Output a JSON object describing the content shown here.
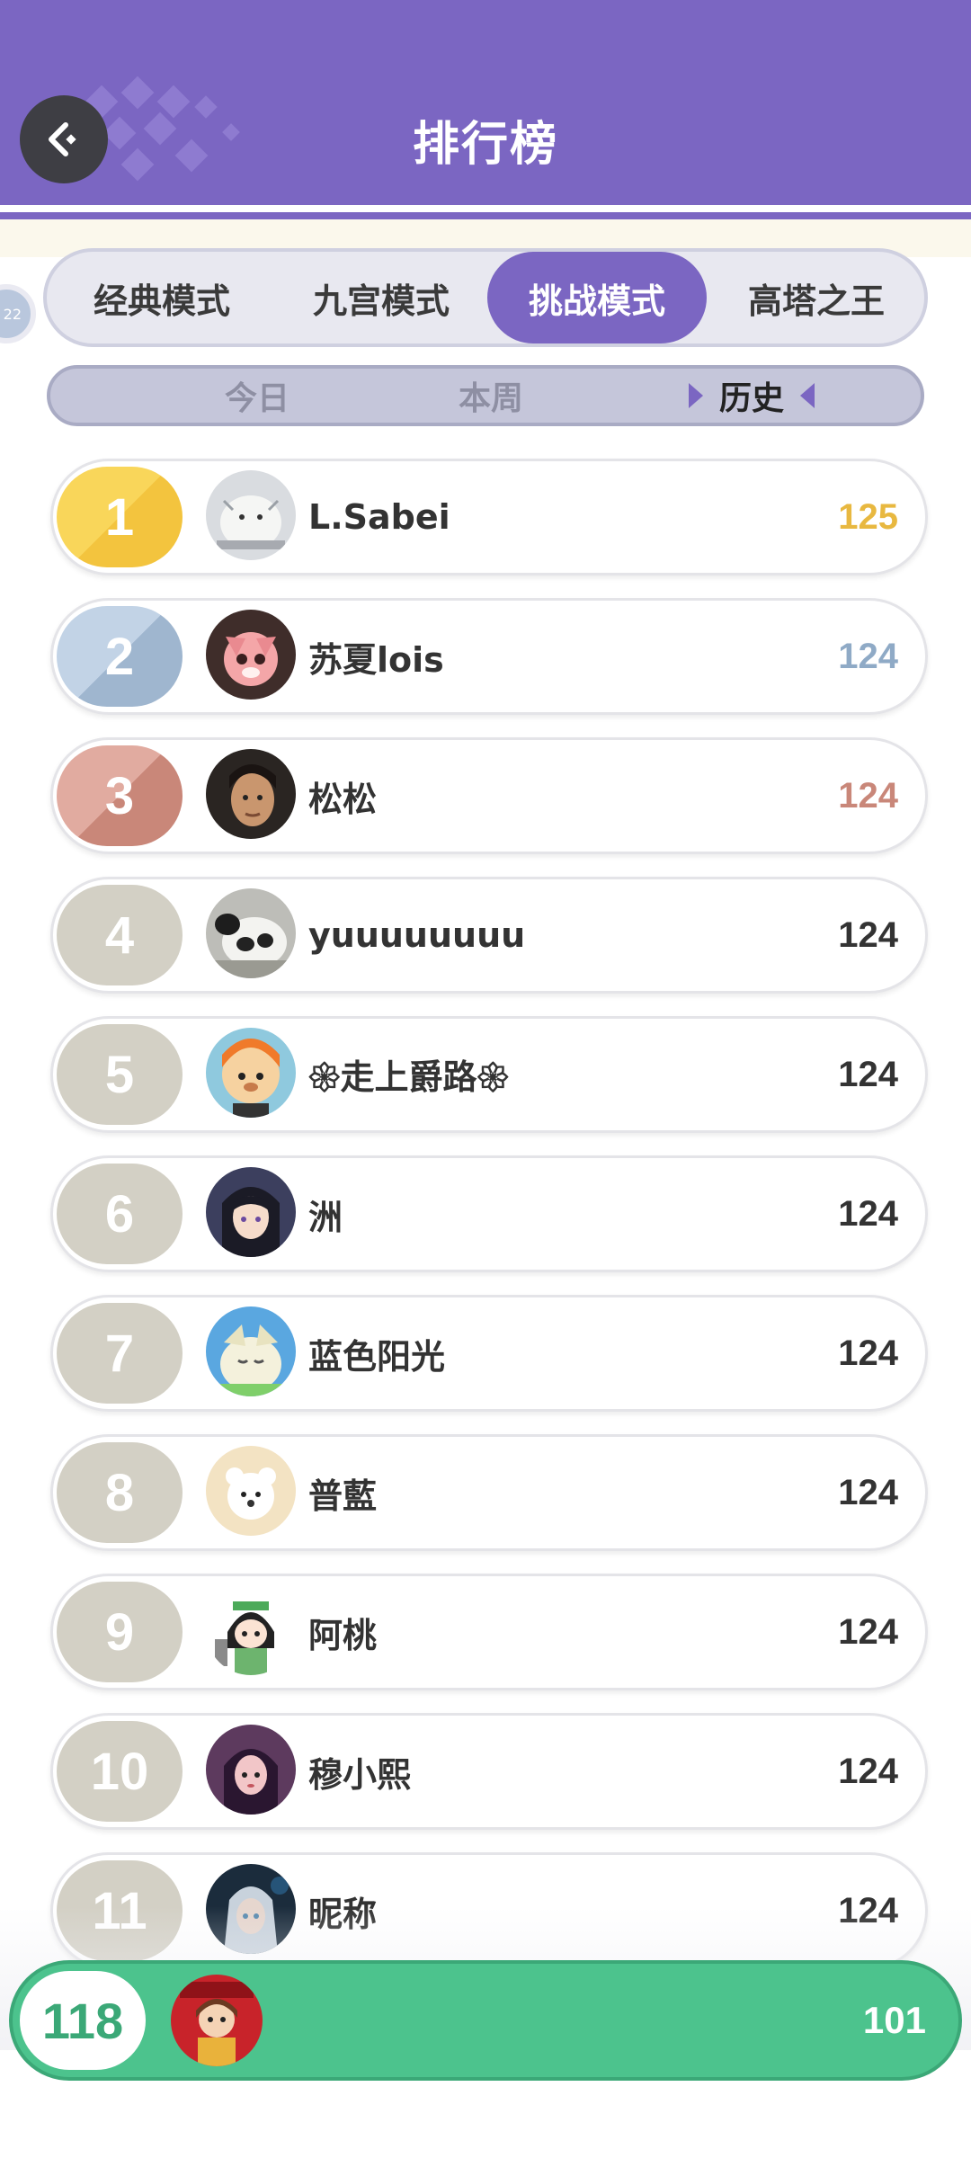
{
  "header": {
    "title": "排行榜"
  },
  "side_badge": {
    "text": "22"
  },
  "mode_tabs": [
    {
      "label": "经典模式",
      "active": false
    },
    {
      "label": "九宫模式",
      "active": false
    },
    {
      "label": "挑战模式",
      "active": true
    },
    {
      "label": "高塔之王",
      "active": false
    }
  ],
  "period_tabs": [
    {
      "label": "今日",
      "active": false
    },
    {
      "label": "本周",
      "active": false
    },
    {
      "label": "历史",
      "active": true
    }
  ],
  "rankings": [
    {
      "rank": "1",
      "name": "L.Sabei",
      "score": "125",
      "medal": "gold",
      "avatar_icon": "white-creature-avatar-icon"
    },
    {
      "rank": "2",
      "name": "苏夏lois",
      "score": "124",
      "medal": "silver",
      "avatar_icon": "pink-fox-avatar-icon"
    },
    {
      "rank": "3",
      "name": "松松",
      "score": "124",
      "medal": "bronze",
      "avatar_icon": "man-portrait-avatar-icon"
    },
    {
      "rank": "4",
      "name": "yuuuuuuuu",
      "score": "124",
      "medal": "",
      "avatar_icon": "panda-avatar-icon"
    },
    {
      "rank": "5",
      "name": "𑁍走上爵路𑁍",
      "score": "124",
      "medal": "",
      "avatar_icon": "cartoon-boy-avatar-icon"
    },
    {
      "rank": "6",
      "name": "洲",
      "score": "124",
      "medal": "",
      "avatar_icon": "anime-girl-avatar-icon"
    },
    {
      "rank": "7",
      "name": "蓝色阳光",
      "score": "124",
      "medal": "",
      "avatar_icon": "sleepy-creature-avatar-icon"
    },
    {
      "rank": "8",
      "name": "普藍",
      "score": "124",
      "medal": "",
      "avatar_icon": "white-dog-avatar-icon"
    },
    {
      "rank": "9",
      "name": "阿桃",
      "score": "124",
      "medal": "",
      "avatar_icon": "chibi-girl-avatar-icon"
    },
    {
      "rank": "10",
      "name": "穆小熙",
      "score": "124",
      "medal": "",
      "avatar_icon": "purple-girl-avatar-icon"
    },
    {
      "rank": "11",
      "name": "昵称",
      "score": "124",
      "medal": "",
      "avatar_icon": "silver-hair-avatar-icon"
    }
  ],
  "my_rank": {
    "rank": "118",
    "score": "101",
    "avatar_icon": "red-costume-avatar-icon"
  },
  "colors": {
    "primary": "#7b66c2",
    "my_rank_bg": "#4cc38d",
    "gold": "#e8b840",
    "silver": "#8faac6",
    "bronze": "#c98779"
  }
}
